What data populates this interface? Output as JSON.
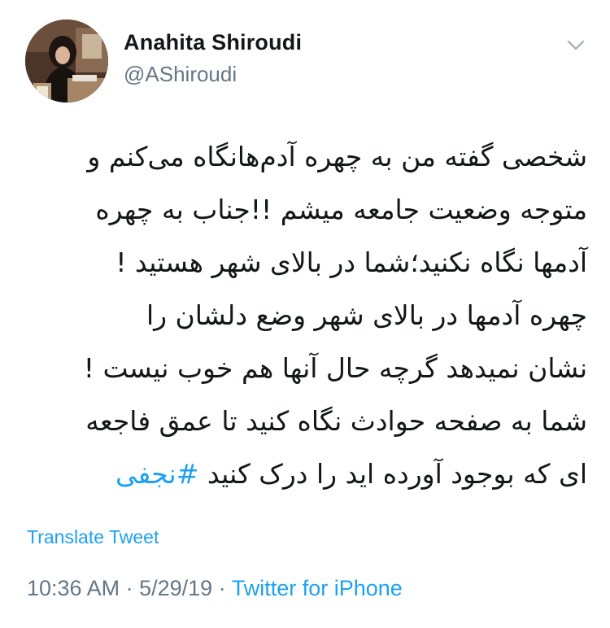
{
  "author": {
    "display_name": "Anahita Shiroudi",
    "handle": "@AShiroudi",
    "avatar_icon": "profile-photo"
  },
  "menu": {
    "icon": "chevron-down-icon"
  },
  "tweet": {
    "lines": [
      "شخصی گفته من به چهره آدم‌هانگاه می‌کنم و",
      "متوجه وضعیت جامعه میشم !!جناب به چهره",
      "آدمها نگاه نکنید؛شما در بالای شهر هستید !",
      "چهره آدمها در بالای شهر وضع دلشان را",
      "نشان نمیدهد گرچه حال آنها هم خوب نیست !",
      "شما به صفحه حوادث نگاه کنید تا عمق فاجعه"
    ],
    "last_line_text": "ای که بوجود آورده اید را درک کنید ",
    "hashtag": "#نجفی"
  },
  "translate_label": "Translate Tweet",
  "meta": {
    "time": "10:36 AM",
    "separator": " · ",
    "date": "5/29/19",
    "source": "Twitter for iPhone"
  },
  "colors": {
    "link": "#1da1f2",
    "secondary_text": "#657786",
    "primary_text": "#14171a"
  }
}
